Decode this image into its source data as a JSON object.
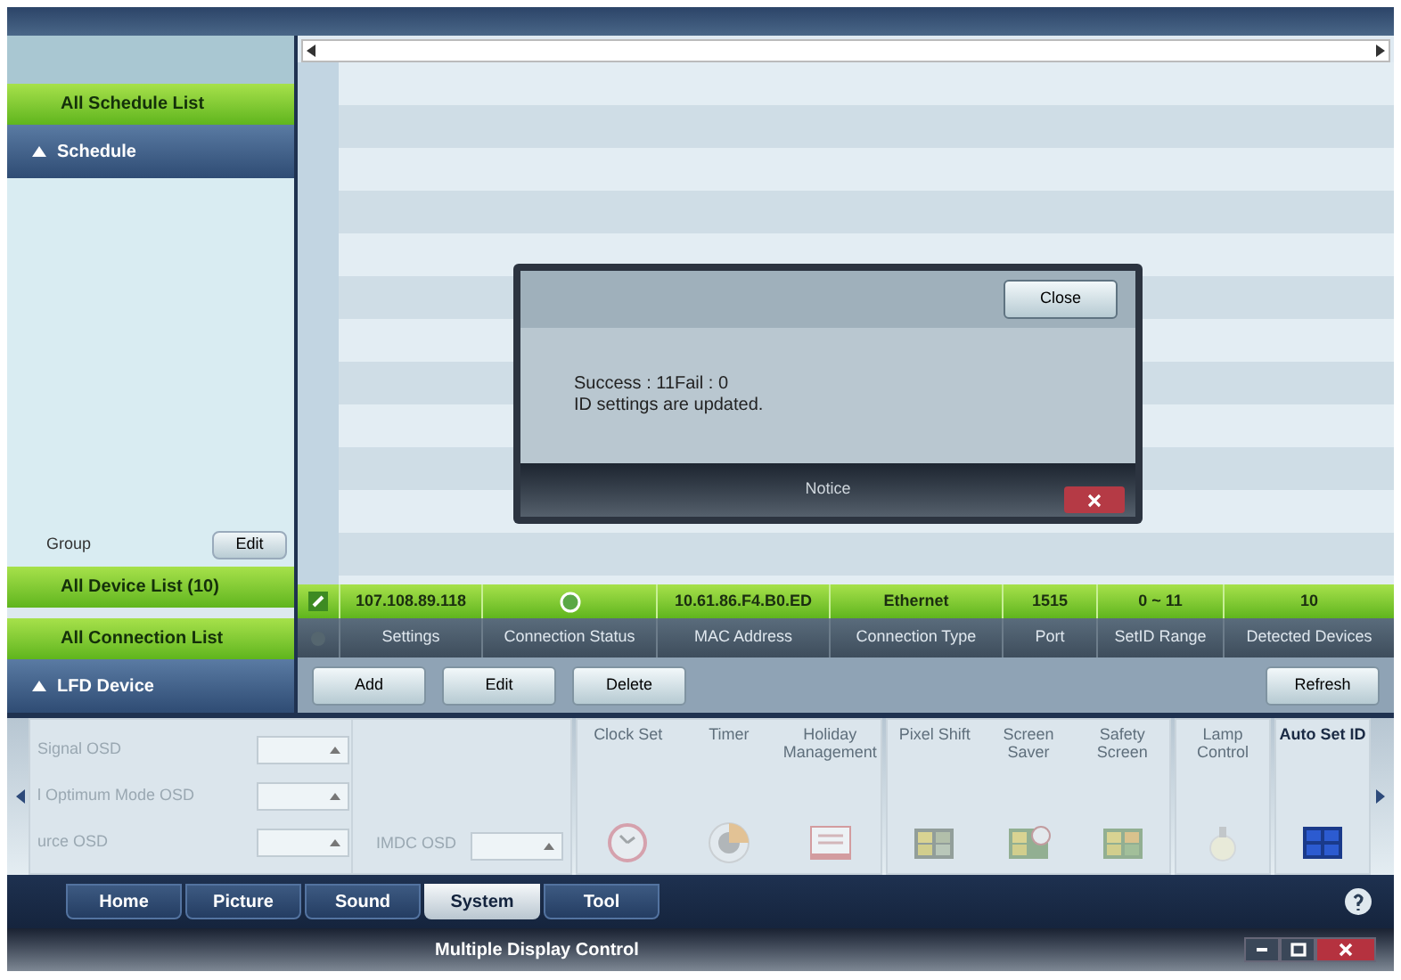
{
  "window": {
    "title": "Multiple Display Control"
  },
  "sidebar": {
    "schedule_link": "All Schedule List",
    "schedule_header": {
      "label": "Schedule",
      "expanded": true
    },
    "group_label": "Group",
    "group_button": "Edit",
    "device_link": "All Device List (10)",
    "connection_link": "All Connection List",
    "device_header": {
      "label": "LFD Device",
      "expanded": true
    }
  },
  "table": {
    "rows": [
      {
        "kind": "device",
        "selected": true,
        "cells": [
          "107.108.89.118",
          "",
          "10.61.86.F4.B0.ED",
          "Ethernet",
          "1515",
          "0 ~ 11",
          "10"
        ]
      },
      {
        "kind": "header",
        "cells": [
          "Settings",
          "Connection Status",
          "MAC Address",
          "Connection Type",
          "Port",
          "SetID Range",
          "Detected Devices"
        ]
      }
    ]
  },
  "actions": [
    "Add",
    "Edit",
    "Delete"
  ],
  "refresh": "Refresh",
  "dialog": {
    "close_button": "Close",
    "lines": [
      "Success : 11Fail : 0",
      "ID settings are updated."
    ],
    "title": "Notice"
  },
  "osd": {
    "fields": [
      {
        "label": "Signal OSD"
      },
      {
        "label": "l Optimum Mode OSD"
      },
      {
        "label": "urce OSD"
      }
    ],
    "mdc_label": "IMDC OSD"
  },
  "tools": [
    {
      "label": "Clock Set",
      "kind": "clock",
      "disabled": true
    },
    {
      "label": "Timer",
      "kind": "timer",
      "disabled": true
    },
    {
      "label": "Holiday Management",
      "kind": "holiday",
      "disabled": true
    },
    {
      "label": "Pixel Shift",
      "kind": "pixel",
      "disabled": true
    },
    {
      "label": "Screen Saver",
      "kind": "saver",
      "disabled": true
    },
    {
      "label": "Safety Screen",
      "kind": "safety",
      "disabled": true
    },
    {
      "label": "Lamp Control",
      "kind": "lamp",
      "disabled": true
    },
    {
      "label": "Auto Set ID",
      "kind": "autoid",
      "disabled": false
    }
  ],
  "tabs": [
    {
      "label": "Home",
      "selected": false
    },
    {
      "label": "Picture",
      "selected": false
    },
    {
      "label": "Sound",
      "selected": false
    },
    {
      "label": "System",
      "selected": true
    },
    {
      "label": "Tool",
      "selected": false
    }
  ]
}
